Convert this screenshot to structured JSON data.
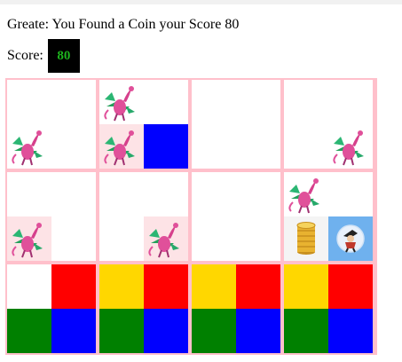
{
  "message": "Greate: You Found a Coin your Score 80",
  "score": {
    "label": "Score:",
    "value": "80"
  },
  "colors": {
    "grid_border": "#ffc0cb",
    "score_text": "#1db31d",
    "red": "#ff0000",
    "blue": "#0000ff",
    "green": "#008000",
    "yellow": "#ffd700",
    "light_blue": "#6fb1ee",
    "pale_pink": "#fde3e6"
  },
  "board": {
    "rows": 3,
    "cols": 4,
    "cells": [
      {
        "row": 0,
        "col": 0,
        "quads": [
          "empty",
          "empty",
          "dragon",
          "empty"
        ]
      },
      {
        "row": 0,
        "col": 1,
        "quads": [
          "dragon",
          "empty",
          "dragon-pink",
          "blue"
        ]
      },
      {
        "row": 0,
        "col": 2,
        "quads": [
          "empty",
          "empty",
          "empty",
          "empty"
        ]
      },
      {
        "row": 0,
        "col": 3,
        "quads": [
          "empty",
          "empty",
          "empty",
          "dragon"
        ]
      },
      {
        "row": 1,
        "col": 0,
        "quads": [
          "empty",
          "empty",
          "dragon-pink",
          "empty"
        ]
      },
      {
        "row": 1,
        "col": 1,
        "quads": [
          "empty",
          "empty",
          "empty",
          "dragon-pink"
        ]
      },
      {
        "row": 1,
        "col": 2,
        "quads": [
          "empty",
          "empty",
          "empty",
          "empty"
        ]
      },
      {
        "row": 1,
        "col": 3,
        "quads": [
          "dragon",
          "empty",
          "coin",
          "player"
        ]
      },
      {
        "row": 2,
        "col": 0,
        "quads": [
          "empty",
          "red",
          "green",
          "blue"
        ]
      },
      {
        "row": 2,
        "col": 1,
        "quads": [
          "yellow",
          "red",
          "green",
          "blue"
        ]
      },
      {
        "row": 2,
        "col": 2,
        "quads": [
          "yellow",
          "red",
          "green",
          "blue"
        ]
      },
      {
        "row": 2,
        "col": 3,
        "quads": [
          "yellow",
          "red",
          "green",
          "blue"
        ]
      }
    ]
  }
}
